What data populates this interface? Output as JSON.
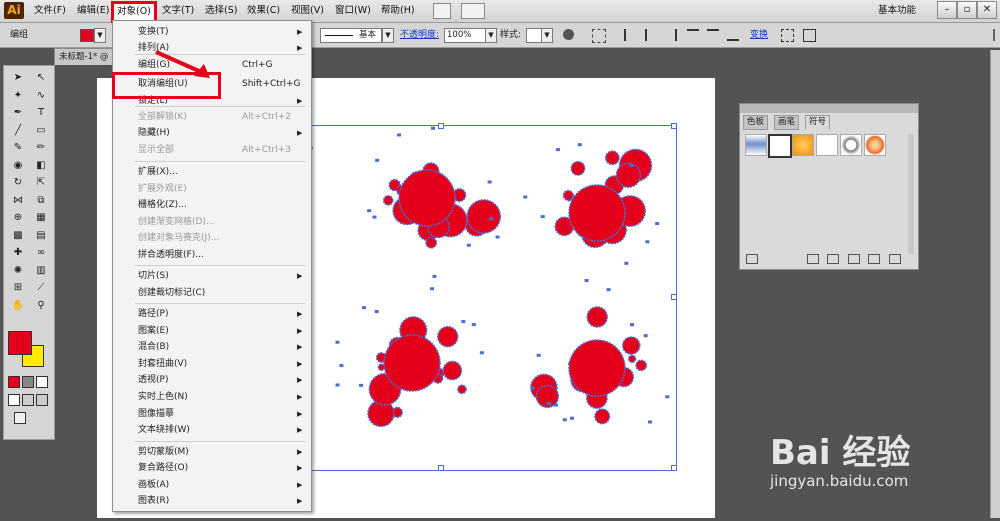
{
  "app": {
    "logo": "Ai",
    "workspace": "基本功能"
  },
  "menubar": {
    "items": [
      "文件(F)",
      "编辑(E)",
      "对象(O)",
      "文字(T)",
      "选择(S)",
      "效果(C)",
      "视图(V)",
      "窗口(W)",
      "帮助(H)"
    ]
  },
  "window_buttons": [
    "–",
    "▫",
    "✕"
  ],
  "control_bar": {
    "group_label": "编组",
    "stroke_style": "基本",
    "opacity_label": "不透明度:",
    "opacity_value": "100%",
    "style_label": "样式:",
    "transform_label": "变换"
  },
  "document_tab": {
    "label": "未标题-1* @"
  },
  "object_menu": {
    "items": [
      {
        "label": "变换(T)",
        "shortcut": "",
        "submenu": true,
        "disabled": false
      },
      {
        "label": "排列(A)",
        "shortcut": "",
        "submenu": true,
        "disabled": false
      },
      {
        "label": "编组(G)",
        "shortcut": "Ctrl+G",
        "submenu": false,
        "disabled": false
      },
      {
        "label": "取消编组(U)",
        "shortcut": "Shift+Ctrl+G",
        "submenu": false,
        "disabled": false
      },
      {
        "label": "锁定(L)",
        "shortcut": "",
        "submenu": true,
        "disabled": false
      },
      {
        "label": "全部解锁(K)",
        "shortcut": "Alt+Ctrl+2",
        "submenu": false,
        "disabled": true
      },
      {
        "label": "隐藏(H)",
        "shortcut": "",
        "submenu": true,
        "disabled": false
      },
      {
        "label": "显示全部",
        "shortcut": "Alt+Ctrl+3",
        "submenu": false,
        "disabled": true
      },
      {
        "label": "扩展(X)...",
        "shortcut": "",
        "submenu": false,
        "disabled": false
      },
      {
        "label": "扩展外观(E)",
        "shortcut": "",
        "submenu": false,
        "disabled": true
      },
      {
        "label": "栅格化(Z)...",
        "shortcut": "",
        "submenu": false,
        "disabled": false
      },
      {
        "label": "创建渐变网格(D)...",
        "shortcut": "",
        "submenu": false,
        "disabled": true
      },
      {
        "label": "创建对象马赛克(J)...",
        "shortcut": "",
        "submenu": false,
        "disabled": true
      },
      {
        "label": "拼合透明度(F)...",
        "shortcut": "",
        "submenu": false,
        "disabled": false
      },
      {
        "label": "切片(S)",
        "shortcut": "",
        "submenu": true,
        "disabled": false
      },
      {
        "label": "创建裁切标记(C)",
        "shortcut": "",
        "submenu": false,
        "disabled": false
      },
      {
        "label": "路径(P)",
        "shortcut": "",
        "submenu": true,
        "disabled": false
      },
      {
        "label": "图案(E)",
        "shortcut": "",
        "submenu": true,
        "disabled": false
      },
      {
        "label": "混合(B)",
        "shortcut": "",
        "submenu": true,
        "disabled": false
      },
      {
        "label": "封套扭曲(V)",
        "shortcut": "",
        "submenu": true,
        "disabled": false
      },
      {
        "label": "透视(P)",
        "shortcut": "",
        "submenu": true,
        "disabled": false
      },
      {
        "label": "实时上色(N)",
        "shortcut": "",
        "submenu": true,
        "disabled": false
      },
      {
        "label": "图像描摹",
        "shortcut": "",
        "submenu": true,
        "disabled": false
      },
      {
        "label": "文本绕排(W)",
        "shortcut": "",
        "submenu": true,
        "disabled": false
      },
      {
        "label": "剪切蒙版(M)",
        "shortcut": "",
        "submenu": true,
        "disabled": false
      },
      {
        "label": "复合路径(O)",
        "shortcut": "",
        "submenu": true,
        "disabled": false
      },
      {
        "label": "画板(A)",
        "shortcut": "",
        "submenu": true,
        "disabled": false
      },
      {
        "label": "图表(R)",
        "shortcut": "",
        "submenu": true,
        "disabled": false
      }
    ]
  },
  "symbols_panel": {
    "tabs": [
      "色板",
      "画笔",
      "符号"
    ],
    "active_tab": "符号"
  },
  "colors": {
    "accent": "#e4001b",
    "fill": "#e4001b",
    "stroke": "#ffea00",
    "selection": "#4a6cd4"
  },
  "watermark": {
    "brand": "Bai 经验",
    "url": "jingyan.baidu.com"
  }
}
